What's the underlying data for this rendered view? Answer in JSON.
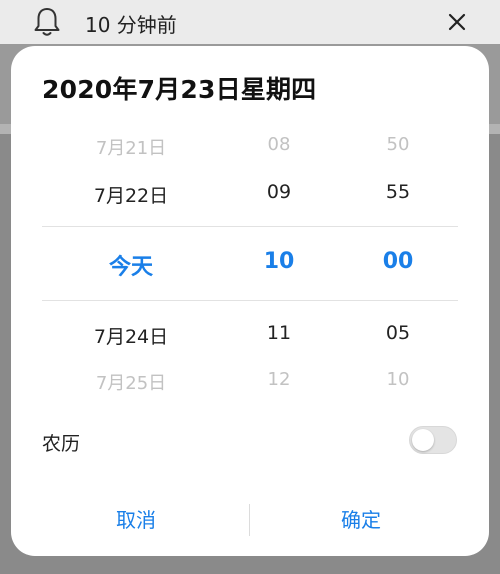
{
  "notification": {
    "reminder_text": "10 分钟前",
    "bell_icon": "bell-icon",
    "close_icon": "close-icon"
  },
  "dialog": {
    "title": "2020年7月23日星期四",
    "picker": {
      "dates": [
        "7月21日",
        "7月22日",
        "今天",
        "7月24日",
        "7月25日"
      ],
      "hours": [
        "08",
        "09",
        "10",
        "11",
        "12"
      ],
      "minutes": [
        "50",
        "55",
        "00",
        "05",
        "10"
      ],
      "selected_index": 2
    },
    "lunar": {
      "label": "农历",
      "enabled": false
    },
    "buttons": {
      "cancel": "取消",
      "confirm": "确定"
    }
  },
  "colors": {
    "accent": "#1a7fe8",
    "overlay": "#8a8a8a",
    "dialog_bg": "#ffffff"
  }
}
